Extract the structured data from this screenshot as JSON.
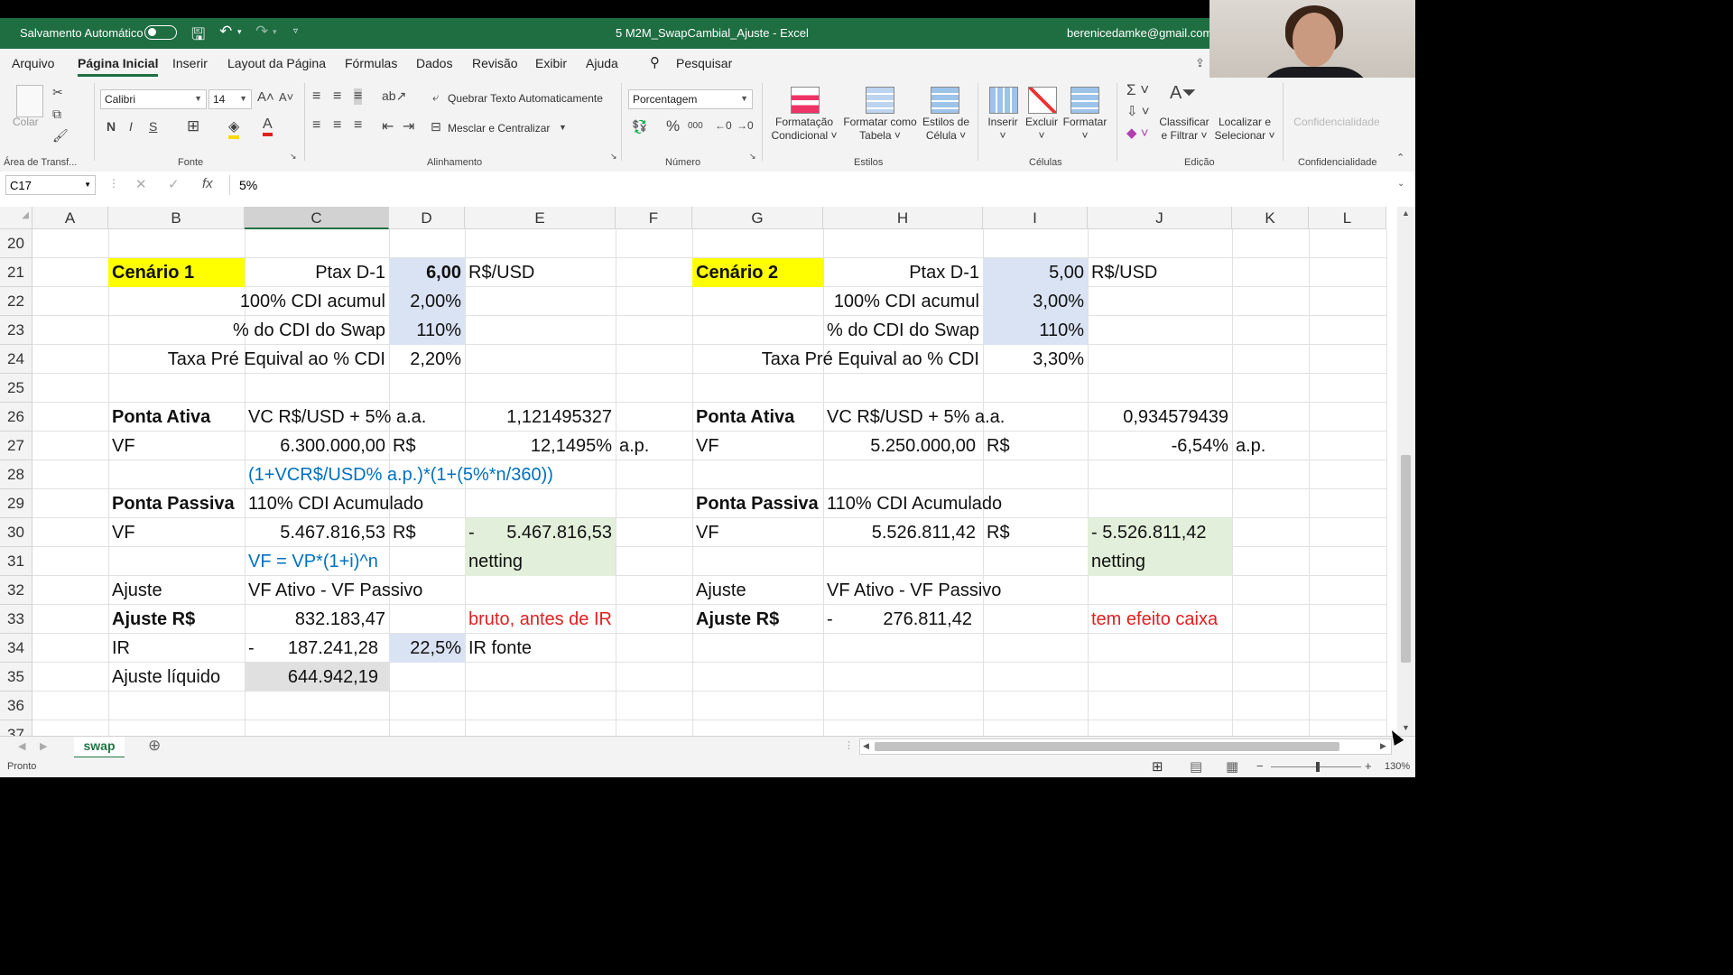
{
  "titlebar": {
    "autosave_label": "Salvamento Automático",
    "doc_title": "5 M2M_SwapCambial_Ajuste  -  Excel",
    "user": "berenicedamke@gmail.com"
  },
  "menu": [
    "Arquivo",
    "Página Inicial",
    "Inserir",
    "Layout da Página",
    "Fórmulas",
    "Dados",
    "Revisão",
    "Exibir",
    "Ajuda"
  ],
  "search_label": "Pesquisar",
  "ribbon": {
    "paste": "Colar",
    "clipboard_group": "Área de Transf...",
    "font_name": "Calibri",
    "font_size": "14",
    "font_group": "Fonte",
    "wrap_text": "Quebrar Texto Automaticamente",
    "merge_center": "Mesclar e Centralizar",
    "alignment_group": "Alinhamento",
    "number_format": "Porcentagem",
    "number_group": "Número",
    "cond_format": [
      "Formatação",
      "Condicional"
    ],
    "format_table": [
      "Formatar como",
      "Tabela"
    ],
    "cell_styles": [
      "Estilos de",
      "Célula"
    ],
    "styles_group": "Estilos",
    "insert": "Inserir",
    "delete": "Excluir",
    "format": "Formatar",
    "cells_group": "Células",
    "sort_filter": [
      "Classificar",
      "e Filtrar"
    ],
    "find_select": [
      "Localizar e",
      "Selecionar"
    ],
    "editing_group": "Edição",
    "confidentiality": "Confidencialidade",
    "conf_group": "Confidencialidade"
  },
  "formula_bar": {
    "name_box": "C17",
    "fx": "fx",
    "value": "5%"
  },
  "columns": [
    "A",
    "B",
    "C",
    "D",
    "E",
    "F",
    "G",
    "H",
    "I",
    "J",
    "K",
    "L"
  ],
  "selected_column": "C",
  "rows": [
    "20",
    "21",
    "22",
    "23",
    "24",
    "25",
    "26",
    "27",
    "28",
    "29",
    "30",
    "31",
    "32",
    "33",
    "34",
    "35",
    "36",
    "37"
  ],
  "cells": {
    "B21": "Cenário 1",
    "C21": "Ptax D-1",
    "D21": "6,00",
    "E21": "R$/USD",
    "C22": "100% CDI acumul",
    "D22": "2,00%",
    "C23": "% do CDI do Swap",
    "D23": "110%",
    "C24": "Taxa Pré Equival ao % CDI",
    "D24": "2,20%",
    "B26": "Ponta Ativa",
    "C26": "VC R$/USD + 5% a.a.",
    "E26": "1,121495327",
    "B27": "VF",
    "C27": "6.300.000,00",
    "D27": "R$",
    "E27": "12,1495%",
    "F27": "a.p.",
    "C28": "(1+VCR$/USD% a.p.)*(1+(5%*n/360))",
    "B29": "Ponta Passiva",
    "C29": "110% CDI Acumulado",
    "B30": "VF",
    "C30": "5.467.816,53",
    "D30": "R$",
    "E30a": "-",
    "E30b": "5.467.816,53",
    "C31": "VF = VP*(1+i)^n",
    "E31": "netting",
    "B32": "Ajuste",
    "C32": "VF Ativo - VF Passivo",
    "B33": "Ajuste R$",
    "C33": "832.183,47",
    "E33": "bruto, antes de IR",
    "B34": "IR",
    "C34a": "-",
    "C34b": "187.241,28",
    "D34": "22,5%",
    "E34": "IR fonte",
    "B35": "Ajuste líquido",
    "C35": "644.942,19",
    "G21": "Cenário 2",
    "H21": "Ptax D-1",
    "I21": "5,00",
    "J21": "R$/USD",
    "H22": "100% CDI acumul",
    "I22": "3,00%",
    "H23": "% do CDI do Swap",
    "I23": "110%",
    "H24": "Taxa Pré Equival ao % CDI",
    "I24": "3,30%",
    "G26": "Ponta Ativa",
    "H26": "VC R$/USD + 5% a.a.",
    "J26": "0,934579439",
    "G27": "VF",
    "H27": "5.250.000,00",
    "I27": "R$",
    "J27": "-6,54%",
    "K27": "a.p.",
    "G29": "Ponta Passiva",
    "H29": "110% CDI Acumulado",
    "G30": "VF",
    "H30": "5.526.811,42",
    "I30": "R$",
    "J30": "- 5.526.811,42",
    "J31": "netting",
    "G32": "Ajuste",
    "H32": "VF Ativo - VF Passivo",
    "G33": "Ajuste R$",
    "H33a": "-",
    "H33b": "276.811,42",
    "J33": "tem efeito caixa"
  },
  "sheet_tab": "swap",
  "status": {
    "ready": "Pronto",
    "zoom": "130%"
  },
  "colors": {
    "excel_green": "#1e6e42",
    "highlight_yellow": "#ffff00",
    "input_blue": "#dae3f3",
    "netting_green": "#e2efda",
    "formula_blue": "#0070c0",
    "note_red": "#e02020"
  }
}
